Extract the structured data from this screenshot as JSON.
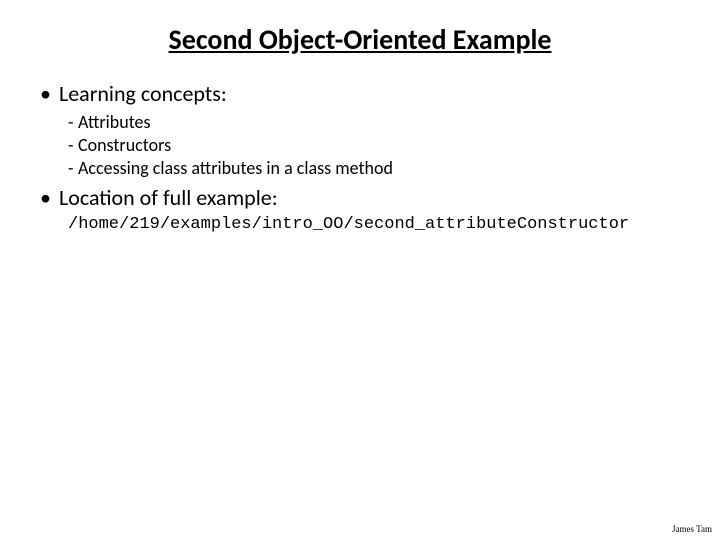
{
  "title": "Second Object-Oriented Example",
  "bullets": [
    {
      "label": "Learning concepts:",
      "subs": [
        "Attributes",
        "Constructors",
        "Accessing class attributes in a class method"
      ]
    },
    {
      "label": "Location of full example:",
      "code": "/home/219/examples/intro_OO/second_attributeConstructor"
    }
  ],
  "footer": "James Tam"
}
